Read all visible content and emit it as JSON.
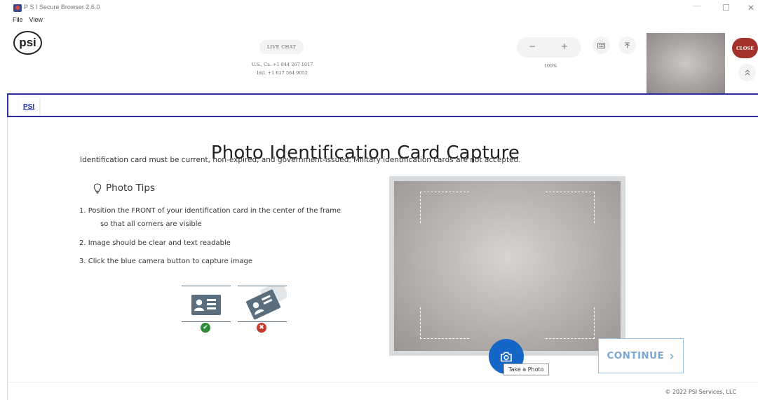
{
  "window": {
    "title": "P S I Secure Browser 2.6.0",
    "controls": {
      "minimize": "—",
      "maximize": "☐",
      "close": "✕"
    }
  },
  "menu": {
    "file": "File",
    "view": "View"
  },
  "header": {
    "logo_text": "psi",
    "live_chat_label": "LIVE CHAT",
    "phone_us": "U.S., Ca. +1 844 267 1017",
    "phone_intl": "Intl. +1 617 564 9052",
    "zoom_minus": "−",
    "zoom_plus": "+",
    "zoom_level": "100%",
    "keyboard_icon": "keyboard-icon",
    "upload_icon": "collapse-top-icon",
    "close_label": "CLOSE",
    "collapse_icon": "double-chevron-up-icon"
  },
  "tabs": [
    {
      "label": "PSI"
    }
  ],
  "main": {
    "title": "Photo Identification Card Capture",
    "requirement": "Identification card must be current, non-expired, and government-issued. Military identification cards are not accepted.",
    "tips_heading": "Photo Tips",
    "tips": [
      "1. Position the FRONT of your identification card in the center of the frame",
      "so that all corners are visible",
      "2. Image should be clear and text readable",
      "3. Click the blue camera button to capture image"
    ],
    "good_example_status": "✔",
    "bad_example_status": "✖",
    "capture_tooltip": "Take a Photo",
    "continue_label": "CONTINUE",
    "continue_chevron": "›"
  },
  "footer": {
    "copyright": "© 2022 PSI Services, LLC"
  },
  "colors": {
    "tab_border": "#2a2e9f",
    "close_button": "#a3322a",
    "capture_button": "#1566c6",
    "continue_text": "#7ba9d4",
    "ok": "#2e8b3a",
    "error": "#c43a2a"
  }
}
